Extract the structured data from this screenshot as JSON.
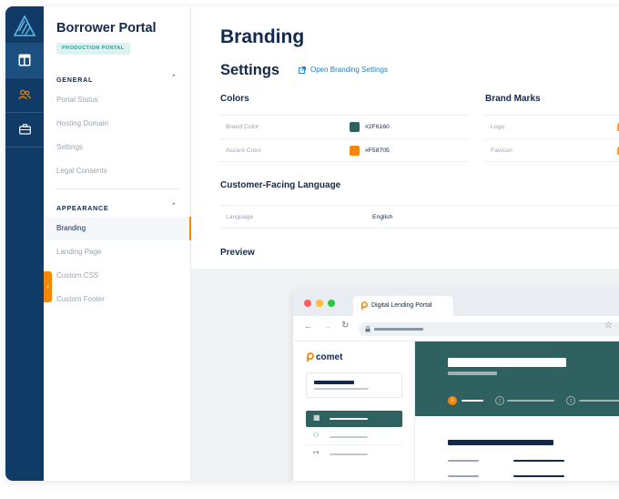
{
  "sidebar": {
    "title": "Borrower Portal",
    "badge": "PRODUCTION PORTAL",
    "general_title": "GENERAL",
    "general_items": [
      "Portal Status",
      "Hosting Domain",
      "Settings",
      "Legal Consents"
    ],
    "appearance_title": "APPEARANCE",
    "appearance_items": [
      "Branding",
      "Landing Page",
      "Custom CSS",
      "Custom Footer"
    ],
    "active_item": "Branding"
  },
  "main": {
    "page_title": "Branding",
    "settings_title": "Settings",
    "open_settings_link": "Open Branding Settings",
    "colors": {
      "title": "Colors",
      "rows": [
        {
          "label": "Brand Color",
          "value": "#2F6160",
          "swatch": "#2F6160"
        },
        {
          "label": "Accent Color",
          "value": "#F58705",
          "swatch": "#F58705"
        }
      ]
    },
    "brand_marks": {
      "title": "Brand Marks",
      "rows": [
        {
          "label": "Logo"
        },
        {
          "label": "Favicon"
        }
      ]
    },
    "language": {
      "title": "Customer-Facing Language",
      "label": "Language",
      "value": "English"
    },
    "preview_title": "Preview",
    "preview": {
      "tab_title": "Digital Lending Portal",
      "logo_text": "comet"
    }
  },
  "colors": {
    "rail": "#0f3b66",
    "brand": "#2F6160",
    "accent": "#F58705",
    "text_dark": "#13294b"
  }
}
